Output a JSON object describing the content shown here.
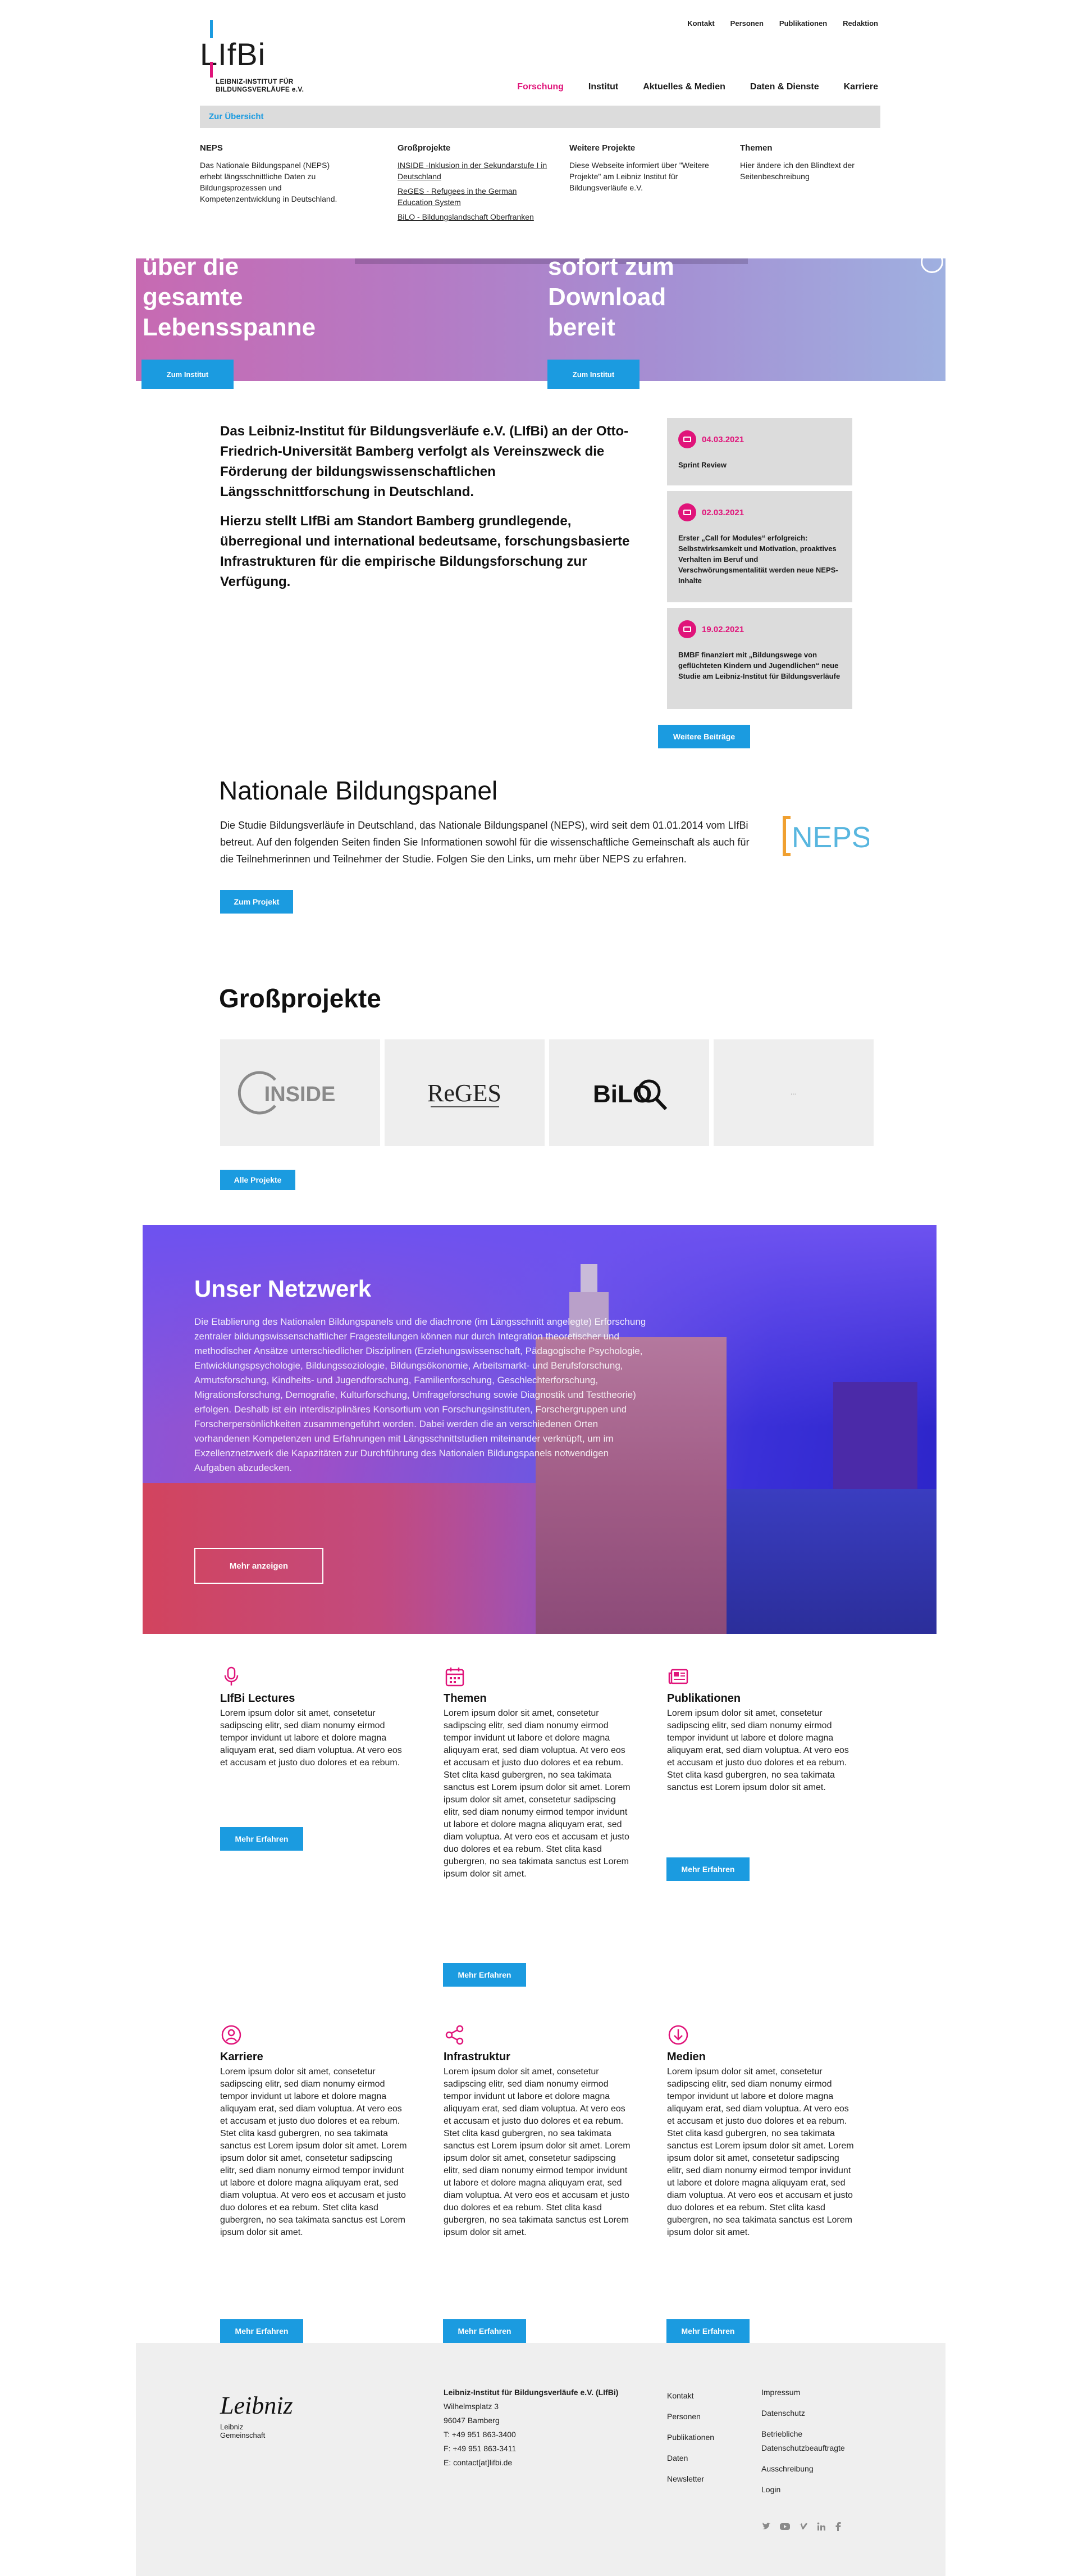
{
  "header": {
    "top_links": [
      "Kontakt",
      "Personen",
      "Publikationen",
      "Redaktion"
    ],
    "logo_text": "LIfBi",
    "logo_sub_1": "LEIBNIZ-INSTITUT FÜR",
    "logo_sub_2": "BILDUNGSVERLÄUFE e.V.",
    "nav": [
      "Forschung",
      "Institut",
      "Aktuelles & Medien",
      "Daten & Dienste",
      "Karriere"
    ],
    "nav_active": "Forschung",
    "overview_link": "Zur Übersicht"
  },
  "mega_menu": {
    "neps": {
      "title": "NEPS",
      "text": "Das Nationale Bildungspanel (NEPS) erhebt längsschnittliche Daten zu Bildungsprozessen und Kompetenzentwicklung in Deutschland."
    },
    "gross": {
      "title": "Großprojekte",
      "links": [
        "INSIDE -Inklusion in der Sekundarstufe I in Deutschland",
        "ReGES - Refugees in the German Education System",
        "BiLO - Bildungslandschaft Oberfranken"
      ]
    },
    "weitere": {
      "title": "Weitere Projekte",
      "text": "Diese Webseite informiert über \"Weitere Projekte\" am Leibniz Institut für Bildungsverläufe e.V."
    },
    "themen": {
      "title": "Themen",
      "text": "Hier ändere ich den Blindtext der Seitenbeschreibung"
    }
  },
  "hero": {
    "left_text_1": "über die",
    "left_text_2": "gesamte",
    "left_text_3": "Lebensspanne",
    "right_text_1": "sofort zum",
    "right_text_2": "Download",
    "right_text_3": "bereit",
    "left_button": "Zum Institut",
    "right_button": "Zum Institut"
  },
  "intro": {
    "p1": "Das Leibniz-Institut für Bildungsverläufe e.V. (LIfBi) an der Otto-Friedrich-Universität Bamberg verfolgt als Vereinszweck die Förderung der bildungswissenschaftlichen Längsschnittforschung in Deutschland.",
    "p2": "Hierzu stellt LIfBi am Standort Bamberg grundlegende, überregional und international bedeutsame, forschungsbasierte Infrastrukturen für die empirische Bildungsforschung zur Verfügung."
  },
  "news": [
    {
      "date": "04.03.2021",
      "text": "Sprint Review"
    },
    {
      "date": "02.03.2021",
      "text": "Erster „Call for Modules“ erfolgreich: Selbstwirksamkeit und Motivation, proaktives Verhalten im Beruf und Verschwörungsmentalität werden neue NEPS-Inhalte"
    },
    {
      "date": "19.02.2021",
      "text": "BMBF finanziert mit „Bildungswege von geflüchteten Kindern und Jugendlichen“ neue Studie am Leibniz-Institut für Bildungsverläufe"
    }
  ],
  "news_button": "Weitere Beiträge",
  "neps": {
    "title": "Nationale Bildungspanel",
    "text": "Die Studie Bildungsverläufe in Deutschland, das Nationale Bildungspanel (NEPS), wird seit dem 01.01.2014 vom LIfBi betreut. Auf den folgenden Seiten finden Sie Informationen sowohl für die wissenschaftliche Gemeinschaft als auch für die Teilnehmerinnen und Teilnehmer der Studie. Folgen Sie den Links, um mehr über NEPS zu erfahren.",
    "button": "Zum Projekt",
    "logo_text": "NEPS"
  },
  "gross": {
    "title": "Großprojekte",
    "tiles": [
      "INSIDE",
      "ReGES",
      "BiLO",
      "..."
    ],
    "button": "Alle Projekte"
  },
  "netzwerk": {
    "title": "Unser Netzwerk",
    "text": "Die Etablierung des Nationalen Bildungspanels und die diachrone (im Längsschnitt angelegte) Erforschung zentraler bildungswissenschaftlicher Fragestellungen können nur durch Integration theoretischer und methodischer Ansätze unterschiedlicher Disziplinen (Erziehungswissenschaft, Pädagogische Psychologie, Entwicklungspsychologie, Bildungssoziologie, Bildungsökonomie, Arbeitsmarkt- und Berufsforschung, Armutsforschung, Kindheits- und Jugendforschung, Familienforschung, Geschlechterforschung, Migrationsforschung, Demografie, Kulturforschung, Umfrageforschung sowie Diagnostik und Testtheorie) erfolgen. Deshalb ist ein interdisziplinäres Konsortium von Forschungsinstituten, Forschergruppen und Forscherpersönlichkeiten zusammengeführt worden. Dabei werden die an verschiedenen Orten vorhandenen Kompetenzen und Erfahrungen mit Längsschnittstudien miteinander verknüpft, um im Exzellenznetzwerk die Kapazitäten zur Durchführung des Nationalen Bildungspanels notwendigen Aufgaben abzudecken.",
    "button": "Mehr anzeigen"
  },
  "features": [
    {
      "icon": "microphone-icon",
      "title": "LIfBi Lectures",
      "text": "Lorem ipsum dolor sit amet, consetetur sadipscing elitr, sed diam nonumy eirmod tempor invidunt ut labore et dolore magna aliquyam erat, sed diam voluptua. At vero eos et accusam et justo duo dolores et ea rebum.",
      "button": "Mehr Erfahren"
    },
    {
      "icon": "calendar-icon",
      "title": "Themen",
      "text": "Lorem ipsum dolor sit amet, consetetur sadipscing elitr, sed diam nonumy eirmod tempor invidunt ut labore et dolore magna aliquyam erat, sed diam voluptua. At vero eos et accusam et justo duo dolores et ea rebum. Stet clita kasd gubergren, no sea takimata sanctus est Lorem ipsum dolor sit amet. Lorem ipsum dolor sit amet, consetetur sadipscing elitr, sed diam nonumy eirmod tempor invidunt ut labore et dolore magna aliquyam erat, sed diam voluptua. At vero eos et accusam et justo duo dolores et ea rebum. Stet clita kasd gubergren, no sea takimata sanctus est Lorem ipsum dolor sit amet.",
      "button": "Mehr Erfahren"
    },
    {
      "icon": "newspaper-icon",
      "title": "Publikationen",
      "text": "Lorem ipsum dolor sit amet, consetetur sadipscing elitr, sed diam nonumy eirmod tempor invidunt ut labore et dolore magna aliquyam erat, sed diam voluptua. At vero eos et accusam et justo duo dolores et ea rebum. Stet clita kasd gubergren, no sea takimata sanctus est Lorem ipsum dolor sit amet.",
      "button": "Mehr Erfahren"
    },
    {
      "icon": "person-icon",
      "title": "Karriere",
      "text": "Lorem ipsum dolor sit amet, consetetur sadipscing elitr, sed diam nonumy eirmod tempor invidunt ut labore et dolore magna aliquyam erat, sed diam voluptua. At vero eos et accusam et justo duo dolores et ea rebum. Stet clita kasd gubergren, no sea takimata sanctus est Lorem ipsum dolor sit amet. Lorem ipsum dolor sit amet, consetetur sadipscing elitr, sed diam nonumy eirmod tempor invidunt ut labore et dolore magna aliquyam erat, sed diam voluptua. At vero eos et accusam et justo duo dolores et ea rebum. Stet clita kasd gubergren, no sea takimata sanctus est Lorem ipsum dolor sit amet.",
      "button": "Mehr Erfahren"
    },
    {
      "icon": "share-icon",
      "title": "Infrastruktur",
      "text": "Lorem ipsum dolor sit amet, consetetur sadipscing elitr, sed diam nonumy eirmod tempor invidunt ut labore et dolore magna aliquyam erat, sed diam voluptua. At vero eos et accusam et justo duo dolores et ea rebum. Stet clita kasd gubergren, no sea takimata sanctus est Lorem ipsum dolor sit amet. Lorem ipsum dolor sit amet, consetetur sadipscing elitr, sed diam nonumy eirmod tempor invidunt ut labore et dolore magna aliquyam erat, sed diam voluptua. At vero eos et accusam et justo duo dolores et ea rebum. Stet clita kasd gubergren, no sea takimata sanctus est Lorem ipsum dolor sit amet.",
      "button": "Mehr Erfahren"
    },
    {
      "icon": "download-icon",
      "title": "Medien",
      "text": "Lorem ipsum dolor sit amet, consetetur sadipscing elitr, sed diam nonumy eirmod tempor invidunt ut labore et dolore magna aliquyam erat, sed diam voluptua. At vero eos et accusam et justo duo dolores et ea rebum. Stet clita kasd gubergren, no sea takimata sanctus est Lorem ipsum dolor sit amet. Lorem ipsum dolor sit amet, consetetur sadipscing elitr, sed diam nonumy eirmod tempor invidunt ut labore et dolore magna aliquyam erat, sed diam voluptua. At vero eos et accusam et justo duo dolores et ea rebum. Stet clita kasd gubergren, no sea takimata sanctus est Lorem ipsum dolor sit amet.",
      "button": "Mehr Erfahren"
    }
  ],
  "footer": {
    "leibniz_word": "Leibniz",
    "leibniz_sub_1": "Leibniz",
    "leibniz_sub_2": "Gemeinschaft",
    "address": [
      "Leibniz-Institut für Bildungsverläufe e.V. (LIfBi)",
      "Wilhelmsplatz 3",
      "96047 Bamberg",
      "T: +49 951 863-3400",
      "F: +49 951 863-3411",
      "E: contact[at]lifbi.de"
    ],
    "col3": [
      "Kontakt",
      "Personen",
      "Publikationen",
      "Daten",
      "Newsletter"
    ],
    "col4": [
      "Impressum",
      "Datenschutz",
      "Betriebliche Datenschutzbeauftragte",
      "Ausschreibung",
      "Login"
    ],
    "socials": [
      "twitter-icon",
      "youtube-icon",
      "vimeo-icon",
      "linkedin-icon",
      "facebook-icon"
    ]
  },
  "colors": {
    "accent_pink": "#e0147a",
    "accent_blue": "#1b9be0",
    "card_grey": "#dcdcdc"
  }
}
